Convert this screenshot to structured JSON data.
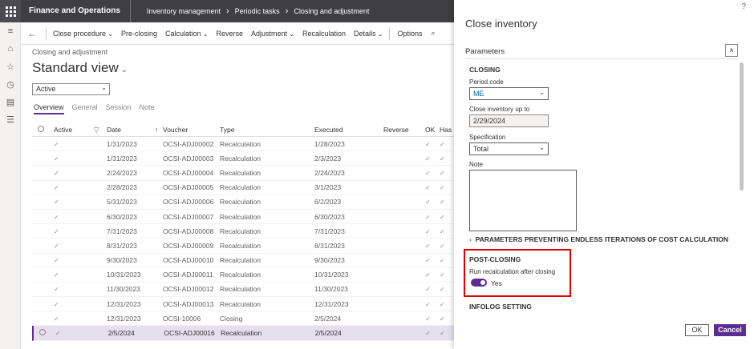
{
  "topbar": {
    "app_title": "Finance and Operations",
    "breadcrumbs": [
      "Inventory management",
      "Periodic tasks",
      "Closing and adjustment"
    ]
  },
  "actions": [
    {
      "label": "Close procedure",
      "caret": true
    },
    {
      "label": "Pre-closing",
      "caret": false
    },
    {
      "label": "Calculation",
      "caret": true
    },
    {
      "label": "Reverse",
      "caret": false
    },
    {
      "label": "Adjustment",
      "caret": true
    },
    {
      "label": "Recalculation",
      "caret": false
    },
    {
      "label": "Details",
      "caret": true
    },
    {
      "label": "Options",
      "caret": false
    }
  ],
  "page": {
    "crumb": "Closing and adjustment",
    "title": "Standard view",
    "filter_value": "Active",
    "tabs": [
      "Overview",
      "General",
      "Session",
      "Note"
    ]
  },
  "grid": {
    "headers": {
      "active": "Active",
      "date": "Date",
      "voucher": "Voucher",
      "type": "Type",
      "executed": "Executed",
      "reverse": "Reverse",
      "ok": "OK",
      "has": "Has"
    },
    "rows": [
      {
        "date": "1/31/2023",
        "voucher": "OCSI-ADJ00002",
        "type": "Recalculation",
        "executed": "1/28/2023"
      },
      {
        "date": "1/31/2023",
        "voucher": "OCSI-ADJ00003",
        "type": "Recalculation",
        "executed": "2/3/2023"
      },
      {
        "date": "2/24/2023",
        "voucher": "OCSI-ADJ00004",
        "type": "Recalculation",
        "executed": "2/24/2023"
      },
      {
        "date": "2/28/2023",
        "voucher": "OCSI-ADJ00005",
        "type": "Recalculation",
        "executed": "3/1/2023"
      },
      {
        "date": "5/31/2023",
        "voucher": "OCSI-ADJ00006",
        "type": "Recalculation",
        "executed": "6/2/2023"
      },
      {
        "date": "6/30/2023",
        "voucher": "OCSI-ADJ00007",
        "type": "Recalculation",
        "executed": "6/30/2023"
      },
      {
        "date": "7/31/2023",
        "voucher": "OCSI-ADJ00008",
        "type": "Recalculation",
        "executed": "7/31/2023"
      },
      {
        "date": "8/31/2023",
        "voucher": "OCSI-ADJ00009",
        "type": "Recalculation",
        "executed": "8/31/2023"
      },
      {
        "date": "9/30/2023",
        "voucher": "OCSI-ADJ00010",
        "type": "Recalculation",
        "executed": "9/30/2023"
      },
      {
        "date": "10/31/2023",
        "voucher": "OCSI-ADJ00011",
        "type": "Recalculation",
        "executed": "10/31/2023"
      },
      {
        "date": "11/30/2023",
        "voucher": "OCSI-ADJ00012",
        "type": "Recalculation",
        "executed": "11/30/2023"
      },
      {
        "date": "12/31/2023",
        "voucher": "OCSI-ADJ00013",
        "type": "Recalculation",
        "executed": "12/31/2023"
      },
      {
        "date": "12/31/2023",
        "voucher": "OCSI-10006",
        "type": "Closing",
        "executed": "2/5/2024"
      },
      {
        "date": "2/5/2024",
        "voucher": "OCSI-ADJ00016",
        "type": "Recalculation",
        "executed": "2/5/2024"
      }
    ]
  },
  "panel": {
    "help": "?",
    "title": "Close inventory",
    "parameters_label": "Parameters",
    "closing_section": "CLOSING",
    "period_code_label": "Period code",
    "period_code_value": "ME",
    "close_upto_label": "Close inventory up to",
    "close_upto_value": "2/29/2024",
    "specification_label": "Specification",
    "specification_value": "Total",
    "note_label": "Note",
    "expander_label": "PARAMETERS PREVENTING ENDLESS ITERATIONS OF COST CALCULATION",
    "post_closing_section": "POST-CLOSING",
    "run_recalc_label": "Run recalculation after closing",
    "run_recalc_value": "Yes",
    "infolog_section": "INFOLOG SETTING",
    "ok_label": "OK",
    "cancel_label": "Cancel"
  },
  "colors": {
    "accent": "#5c2e91",
    "highlight": "#e00000",
    "topbar": "#3f3f42"
  }
}
